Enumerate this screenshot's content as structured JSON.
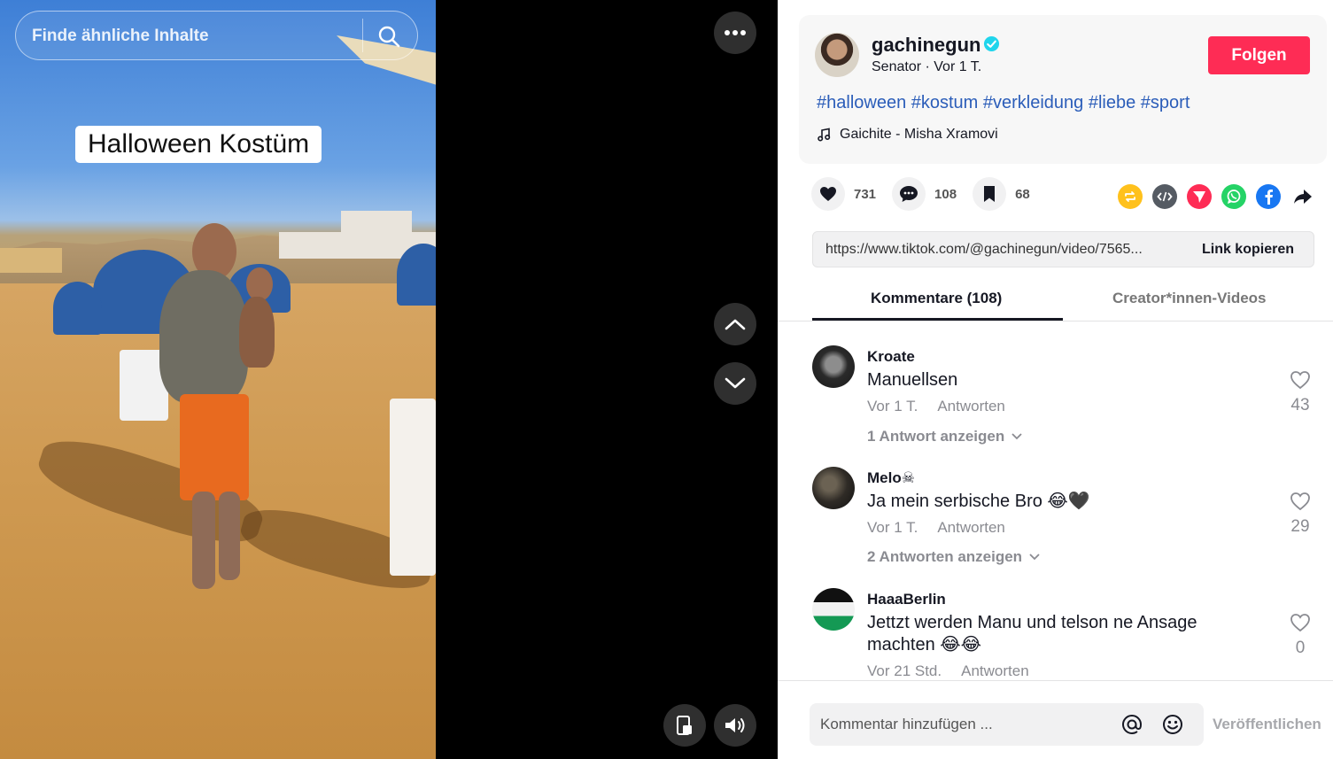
{
  "search": {
    "placeholder": "Finde ähnliche Inhalte"
  },
  "video": {
    "caption": "Halloween Kostüm"
  },
  "author": {
    "username": "gachinegun",
    "subtitle": "Senator · Vor 1 T.",
    "follow_label": "Folgen"
  },
  "description": {
    "hashtags": "#halloween #kostum #verkleidung #liebe #sport",
    "music": "Gaichite - Misha Xramovi"
  },
  "stats": {
    "likes": "731",
    "comments": "108",
    "saves": "68"
  },
  "share": {
    "url": "https://www.tiktok.com/@gachinegun/video/7565...",
    "copy_label": "Link kopieren"
  },
  "tabs": [
    {
      "label": "Kommentare (108)",
      "active": true
    },
    {
      "label": "Creator*innen-Videos",
      "active": false
    }
  ],
  "comments": [
    {
      "user": "Kroate",
      "text": "Manuellsen",
      "time": "Vor 1 T.",
      "reply_label": "Antworten",
      "replies": "1 Antwort anzeigen",
      "likes": "43"
    },
    {
      "user": "Melo☠",
      "text": "Ja mein serbische Bro 😂🖤",
      "time": "Vor 1 T.",
      "reply_label": "Antworten",
      "replies": "2 Antworten anzeigen",
      "likes": "29"
    },
    {
      "user": "HaaaBerlin",
      "text": "Jettzt werden Manu und telson ne Ansage machten 😂😂",
      "time": "Vor 21 Std.",
      "reply_label": "Antworten",
      "likes": "0"
    }
  ],
  "compose": {
    "placeholder": "Kommentar hinzufügen ...",
    "publish_label": "Veröffentlichen"
  },
  "colors": {
    "brand": "#fe2c55",
    "hashtag": "#2b5db9",
    "verified": "#20d5ec"
  }
}
